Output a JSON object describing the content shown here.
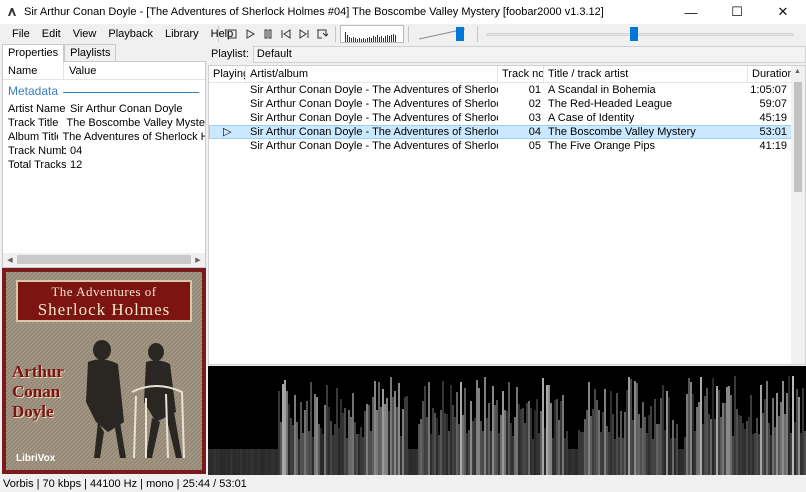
{
  "window": {
    "title": "Sir Arthur Conan Doyle - [The Adventures of Sherlock Holmes #04] The Boscombe Valley Mystery  [foobar2000 v1.3.12]",
    "minimize_glyph": "—",
    "maximize_glyph": "☐",
    "close_glyph": "✕"
  },
  "menu": [
    "File",
    "Edit",
    "View",
    "Playback",
    "Library",
    "Help"
  ],
  "volume_level": 0.82,
  "seek_position": 0.48,
  "left_tabs": {
    "properties": "Properties",
    "playlists": "Playlists"
  },
  "properties": {
    "col_name": "Name",
    "col_value": "Value",
    "section": "Metadata",
    "rows": [
      {
        "k": "Artist Name",
        "v": "Sir Arthur Conan Doyle"
      },
      {
        "k": "Track Title",
        "v": "The Boscombe Valley Mystery"
      },
      {
        "k": "Album Title",
        "v": "The Adventures of Sherlock Holm"
      },
      {
        "k": "Track Number",
        "v": "04"
      },
      {
        "k": "Total Tracks",
        "v": "12"
      }
    ]
  },
  "cover": {
    "title_line1": "The Adventures of",
    "title_line2": "Sherlock Holmes",
    "author_line1": "Arthur",
    "author_line2": "Conan",
    "author_line3": "Doyle",
    "publisher": "LibriVox"
  },
  "playlist_label": "Playlist:",
  "playlist_name": "Default",
  "playlist_columns": {
    "playing": "Playing",
    "artist": "Artist/album",
    "track": "Track no",
    "title": "Title / track artist",
    "duration": "Duration"
  },
  "tracks": [
    {
      "playing": "",
      "artist": "Sir Arthur Conan Doyle - The Adventures of Sherlock Holmes",
      "track": "01",
      "title": "A Scandal in Bohemia",
      "duration": "1:05:07"
    },
    {
      "playing": "",
      "artist": "Sir Arthur Conan Doyle - The Adventures of Sherlock Holmes",
      "track": "02",
      "title": "The Red-Headed League",
      "duration": "59:07"
    },
    {
      "playing": "",
      "artist": "Sir Arthur Conan Doyle - The Adventures of Sherlock Holmes",
      "track": "03",
      "title": "A Case of Identity",
      "duration": "45:19"
    },
    {
      "playing": "▷",
      "artist": "Sir Arthur Conan Doyle - The Adventures of Sherlock Holmes",
      "track": "04",
      "title": "The Boscombe Valley Mystery",
      "duration": "53:01"
    },
    {
      "playing": "",
      "artist": "Sir Arthur Conan Doyle - The Adventures of Sherlock Holmes",
      "track": "05",
      "title": "The Five Orange Pips",
      "duration": "41:19"
    }
  ],
  "selected_track_index": 3,
  "status": "Vorbis | 70 kbps | 44100 Hz | mono | 25:44 / 53:01"
}
